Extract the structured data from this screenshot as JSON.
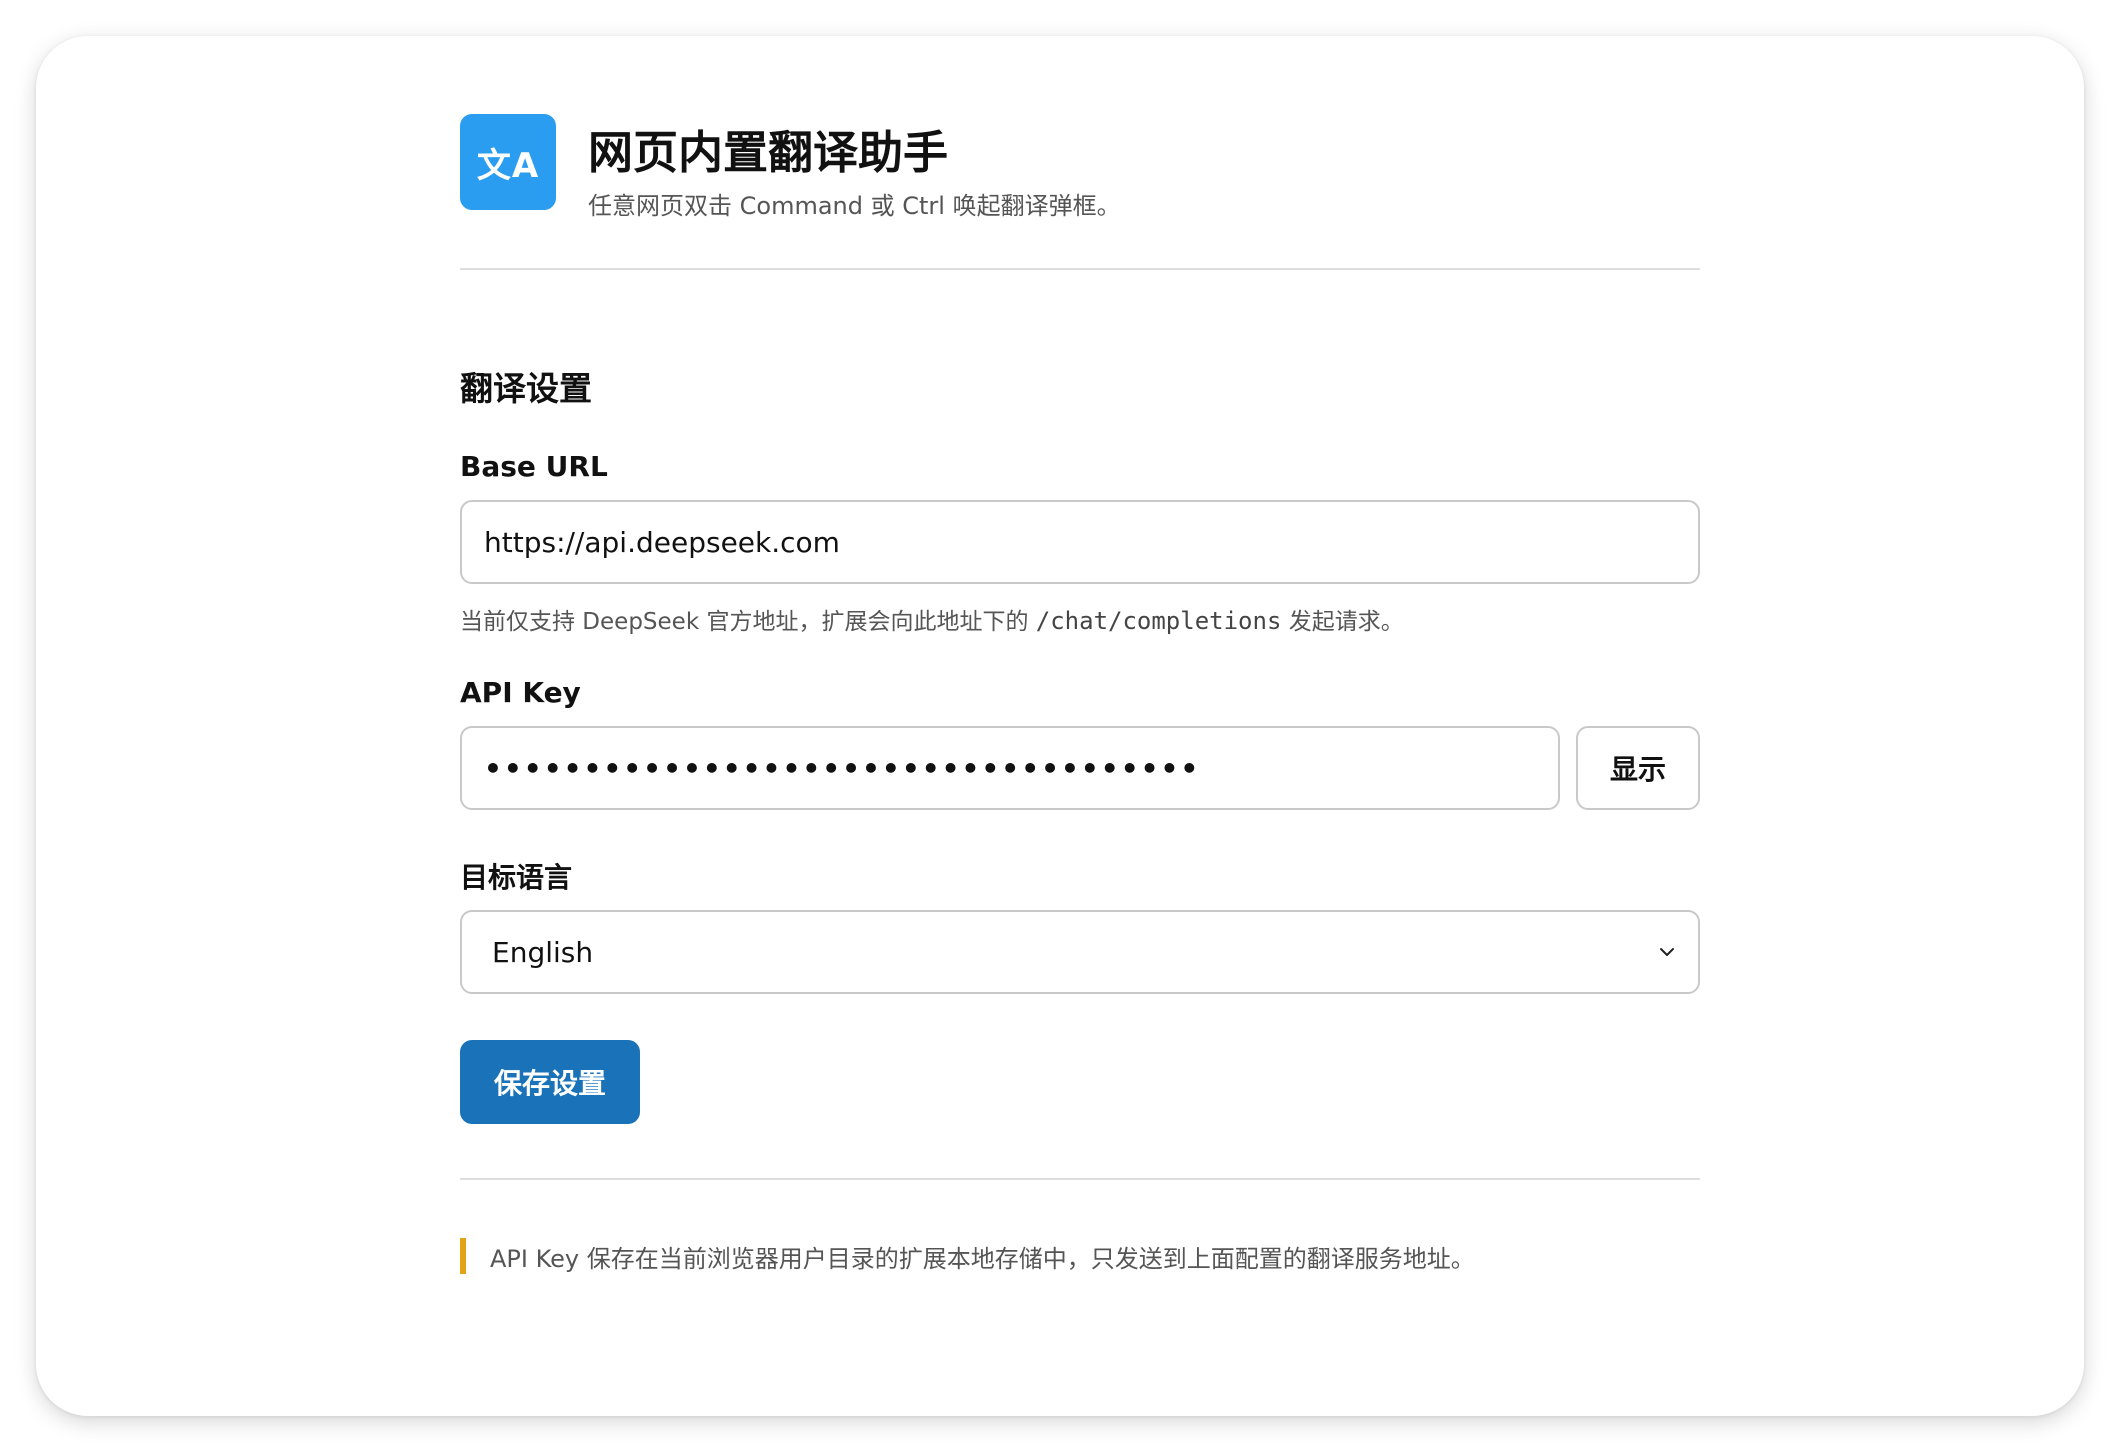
{
  "header": {
    "logo_text": "文A",
    "title": "网页内置翻译助手",
    "subtitle": "任意网页双击 Command 或 Ctrl 唤起翻译弹框。"
  },
  "settings": {
    "section_title": "翻译设置",
    "base_url": {
      "label": "Base URL",
      "value": "https://api.deepseek.com",
      "hint_prefix": "当前仅支持 DeepSeek 官方地址，扩展会向此地址下的 ",
      "hint_code": "/chat/completions",
      "hint_suffix": " 发起请求。"
    },
    "api_key": {
      "label": "API Key",
      "masked_value": "••••••••••••••••••••••••••••••••••••",
      "show_label": "显示"
    },
    "target_language": {
      "label": "目标语言",
      "selected": "English"
    },
    "save_label": "保存设置"
  },
  "footer_note": "API Key 保存在当前浏览器用户目录的扩展本地存储中，只发送到上面配置的翻译服务地址。",
  "colors": {
    "logo": "#2a9df0",
    "primary_button": "#1a73b8",
    "note_accent": "#e2a417"
  },
  "icons": {
    "select_caret": "chevron-down-icon"
  }
}
